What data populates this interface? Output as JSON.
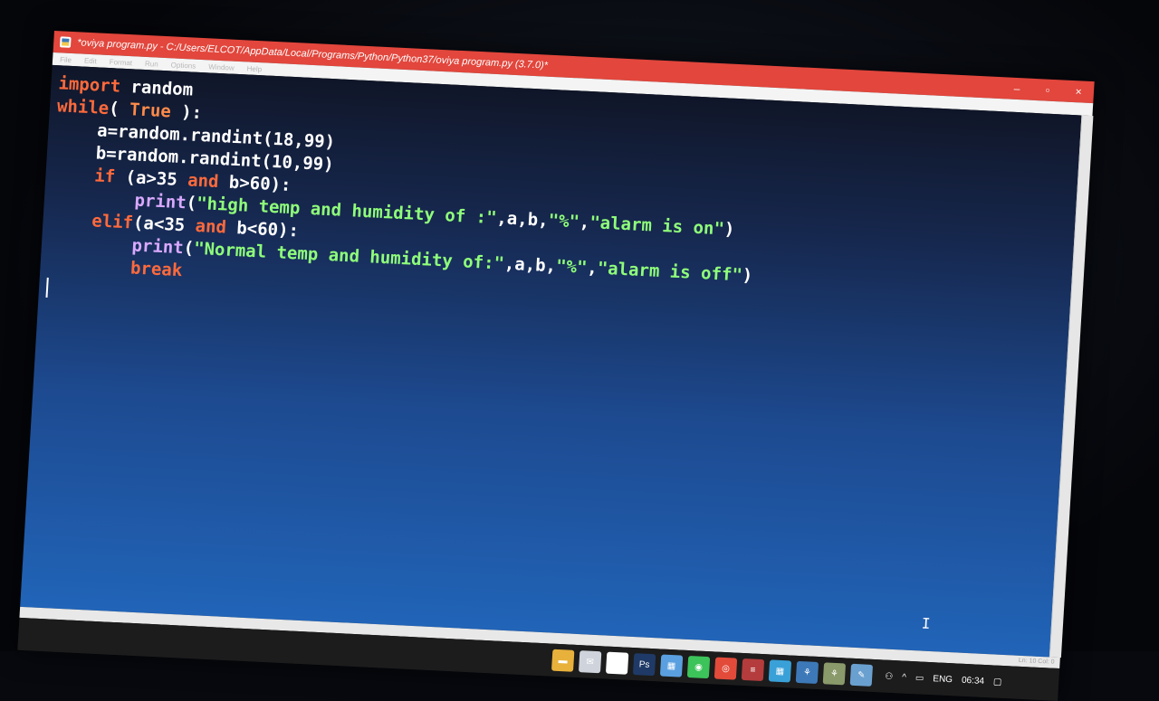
{
  "window": {
    "title": "*oviya program.py - C:/Users/ELCOT/AppData/Local/Programs/Python/Python37/oviya program.py (3.7.0)*",
    "minimize": "–",
    "maximize": "▫",
    "close": "×"
  },
  "menu": [
    "File",
    "Edit",
    "Format",
    "Run",
    "Options",
    "Window",
    "Help"
  ],
  "code": {
    "line1": {
      "kw": "import",
      "rest": " random"
    },
    "line2": {
      "kw": "while",
      "p1": "( ",
      "val": "True",
      "p2": " ):"
    },
    "line3": "    a=random.randint(18,99)",
    "line4": "    b=random.randint(10,99)",
    "line5": {
      "indent": "    ",
      "kw": "if",
      "a": " (a>35 ",
      "op": "and",
      "b": " b>60):"
    },
    "line6": {
      "indent": "        ",
      "fn": "print",
      "open": "(",
      "s1": "\"high temp and humidity of :\"",
      "mid": ",a,b,",
      "s2": "\"%\"",
      "comma": ",",
      "s3": "\"alarm is on\"",
      "close": ")"
    },
    "line7": {
      "indent": "    ",
      "kw": "elif",
      "a": "(a<35 ",
      "op": "and",
      "b": " b<60):"
    },
    "line8": {
      "indent": "        ",
      "fn": "print",
      "open": "(",
      "s1": "\"Normal temp and humidity of:\"",
      "mid": ",a,b,",
      "s2": "\"%\"",
      "comma": ",",
      "s3": "\"alarm is off\"",
      "close": ")"
    },
    "line9": {
      "indent": "        ",
      "kw": "break"
    }
  },
  "status": {
    "position": "Ln: 10  Col: 0"
  },
  "taskbar": {
    "icons": [
      {
        "name": "folder-icon",
        "color": "#e8b13b",
        "glyph": "▬"
      },
      {
        "name": "mail-icon",
        "color": "#cfd4dc",
        "glyph": "✉"
      },
      {
        "name": "document-icon",
        "color": "#ffffff",
        "glyph": "▤"
      },
      {
        "name": "photoshop-icon",
        "color": "#1f3a66",
        "glyph": "Ps"
      },
      {
        "name": "store-icon",
        "color": "#5aa0e0",
        "glyph": "▦"
      },
      {
        "name": "whatsapp-icon",
        "color": "#3cc35a",
        "glyph": "◉"
      },
      {
        "name": "chrome-icon",
        "color": "#e24b3a",
        "glyph": "◎"
      },
      {
        "name": "archive-icon",
        "color": "#b43c3c",
        "glyph": "≡"
      },
      {
        "name": "calculator-icon",
        "color": "#3aa0d8",
        "glyph": "▦"
      },
      {
        "name": "python-icon",
        "color": "#3d79b8",
        "glyph": "⚘"
      },
      {
        "name": "python-shell-icon",
        "color": "#8a9a6a",
        "glyph": "⚘"
      },
      {
        "name": "idle-editor-icon",
        "color": "#6aa0d0",
        "glyph": "✎"
      }
    ],
    "language": "ENG",
    "time": "06:34"
  }
}
